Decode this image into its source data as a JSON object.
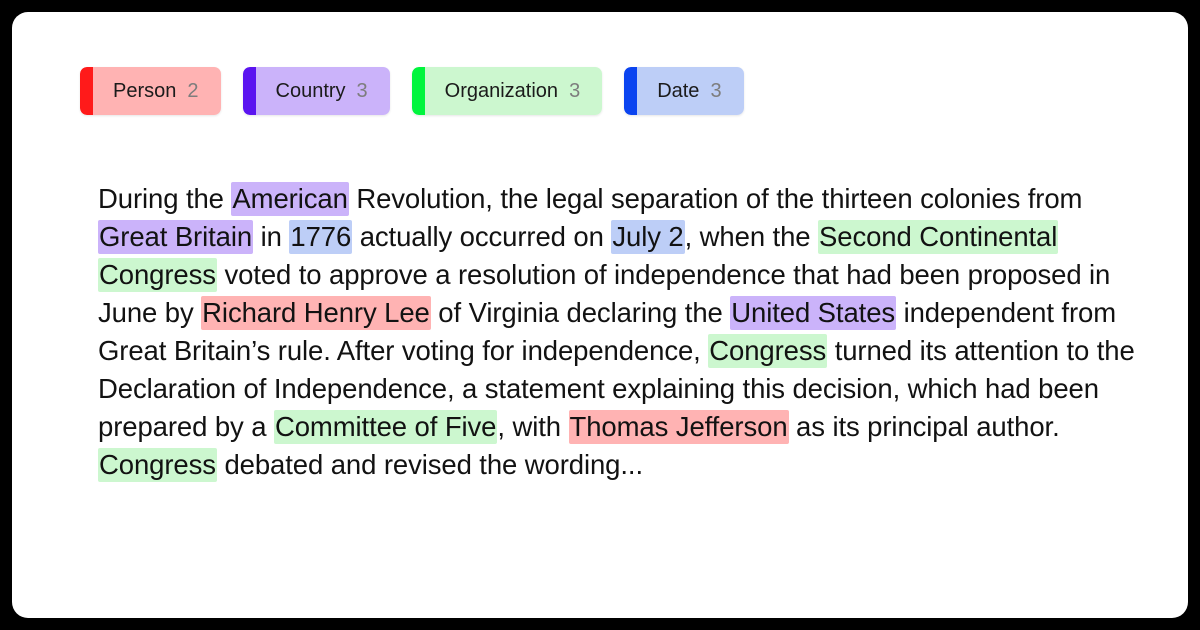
{
  "card": {
    "background": "#ffffff",
    "page_background": "#000000"
  },
  "legend": {
    "name": "entity-legend",
    "items": [
      {
        "label": "Person",
        "count": "2",
        "bar_color": "#ff1a1a",
        "fill_color": "#ffb3b3"
      },
      {
        "label": "Country",
        "count": "3",
        "bar_color": "#5b14f0",
        "fill_color": "#cbb3fa"
      },
      {
        "label": "Organization",
        "count": "3",
        "bar_color": "#00f53d",
        "fill_color": "#ccf7cf"
      },
      {
        "label": "Date",
        "count": "3",
        "bar_color": "#0b44f0",
        "fill_color": "#bdcef7"
      }
    ]
  },
  "passage": {
    "name": "annotated-passage",
    "full_text": "During the American Revolution, the legal separation of the thirteen colonies from Great Britain in 1776 actually occurred on July 2, when the Second Continental Congress voted to approve a resolution of independence that had been proposed in June by Richard Henry Lee of Virginia declaring the United States independent from  Great Britain’s rule. After voting for independence, Congress turned its attention to the Declaration of Independence, a statement explaining this decision, which had been prepared by a Committee of Five, with Thomas Jefferson as its principal author. Congress debated and revised the wording...",
    "tokens": [
      {
        "text": "During the ",
        "type": "plain"
      },
      {
        "text": "American",
        "type": "Country"
      },
      {
        "text": " Revolution, the legal separation of the thirteen colonies from ",
        "type": "plain"
      },
      {
        "text": "Great Britain",
        "type": "Country"
      },
      {
        "text": " in ",
        "type": "plain"
      },
      {
        "text": "1776",
        "type": "Date"
      },
      {
        "text": " actually occurred on ",
        "type": "plain"
      },
      {
        "text": "July 2",
        "type": "Date"
      },
      {
        "text": ", when the ",
        "type": "plain"
      },
      {
        "text": "Second Continental Congress",
        "type": "Organization"
      },
      {
        "text": " voted to approve a resolution of independence that had been proposed in June by ",
        "type": "plain"
      },
      {
        "text": "Richard Henry Lee",
        "type": "Person"
      },
      {
        "text": " of Virginia declaring the ",
        "type": "plain"
      },
      {
        "text": "United States",
        "type": "Country"
      },
      {
        "text": " independent from  Great Britain’s rule. After voting for independence, ",
        "type": "plain"
      },
      {
        "text": "Congress",
        "type": "Organization"
      },
      {
        "text": " turned its attention to the Declaration of Independence, a statement explaining this decision, which had been prepared by a ",
        "type": "plain"
      },
      {
        "text": "Committee of Five",
        "type": "Organization"
      },
      {
        "text": ", with ",
        "type": "plain"
      },
      {
        "text": "Thomas Jefferson",
        "type": "Person"
      },
      {
        "text": " as its principal author. ",
        "type": "plain"
      },
      {
        "text": "Congress",
        "type": "Organization"
      },
      {
        "text": " debated and revised the wording...",
        "type": "plain"
      }
    ],
    "entity_colors": {
      "Person": "#ffb3b3",
      "Country": "#cbb3fa",
      "Organization": "#ccf7cf",
      "Date": "#bdcef7"
    }
  }
}
